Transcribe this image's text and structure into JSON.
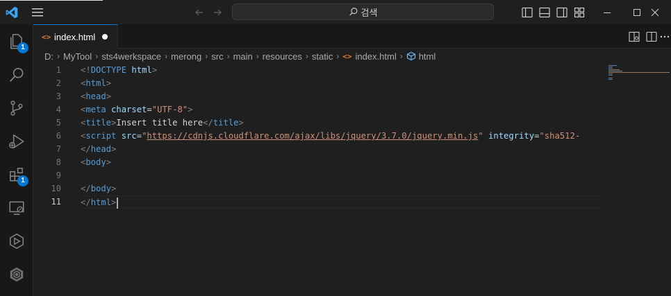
{
  "titlebar": {
    "search_label": "검색"
  },
  "activity": {
    "explorer_badge": "1",
    "extensions_badge": "1"
  },
  "tab": {
    "icon": "<>",
    "label": "index.html"
  },
  "breadcrumb": {
    "items": [
      "D:",
      "MyTool",
      "sts4werkspace",
      "merong",
      "src",
      "main",
      "resources",
      "static"
    ],
    "file_icon": "<>",
    "file": "index.html",
    "symbol": "html"
  },
  "editor": {
    "line_numbers": [
      "1",
      "2",
      "3",
      "4",
      "5",
      "6",
      "7",
      "8",
      "9",
      "10",
      "11"
    ],
    "line1": {
      "open": "<!",
      "kw": "DOCTYPE",
      "sp": " ",
      "attr": "html",
      "close": ">"
    },
    "line2": {
      "open": "<",
      "tn": "html",
      "close": ">"
    },
    "line3": {
      "open": "<",
      "tn": "head",
      "close": ">"
    },
    "line4": {
      "open": "<",
      "tn": "meta",
      "sp": " ",
      "at": "charset",
      "eq": "=",
      "av": "\"UTF-8\"",
      "close": ">"
    },
    "line5": {
      "open": "<",
      "tn": "title",
      "close": ">",
      "text": "Insert title here",
      "open2": "</",
      "tn2": "title",
      "close2": ">"
    },
    "line6": {
      "open": "<",
      "tn": "script",
      "sp": " ",
      "at": "src",
      "eq": "=",
      "q1": "\"",
      "url": "https://cdnjs.cloudflare.com/ajax/libs/jquery/3.7.0/jquery.min.js",
      "q2": "\"",
      "sp2": " ",
      "at2": "integrity",
      "eq2": "=",
      "av2": "\"sha512-"
    },
    "line7": {
      "open": "</",
      "tn": "head",
      "close": ">"
    },
    "line8": {
      "open": "<",
      "tn": "body",
      "close": ">"
    },
    "line10": {
      "open": "</",
      "tn": "body",
      "close": ">"
    },
    "line11": {
      "open": "</",
      "tn": "html",
      "close": ">"
    }
  },
  "colors": {
    "accent": "#0078d4",
    "tag_name": "#569cd6",
    "attribute": "#9cdcfe",
    "string": "#ce9178",
    "html_icon": "#e37933"
  }
}
